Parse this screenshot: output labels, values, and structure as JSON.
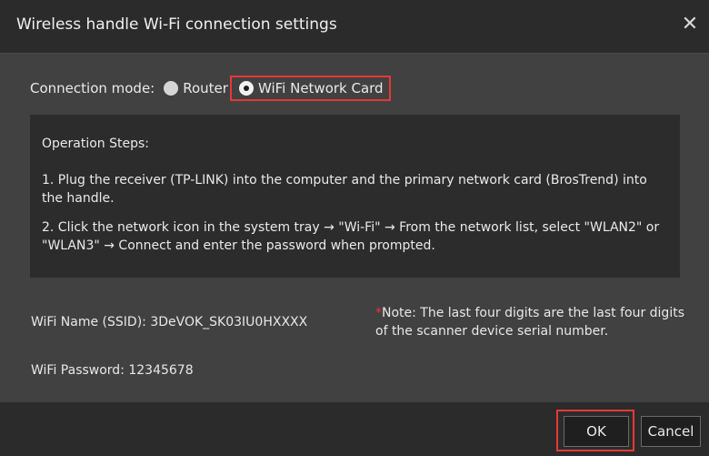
{
  "dialog": {
    "title": "Wireless handle Wi-Fi connection settings",
    "close_glyph": "✕"
  },
  "connection": {
    "label": "Connection mode:",
    "options": [
      {
        "label": "Router",
        "selected": false
      },
      {
        "label": "WiFi Network Card",
        "selected": true
      }
    ]
  },
  "steps": {
    "heading": "Operation Steps:",
    "step1": "1. Plug the receiver (TP-LINK) into the computer and the primary network card (BrosTrend) into the handle.",
    "step2": "2. Click the network icon in the system tray → \"Wi-Fi\" → From the network list, select \"WLAN2\" or \"WLAN3\" → Connect and enter the password when prompted."
  },
  "wifi": {
    "ssid": "WiFi Name (SSID): 3DeVOK_SK03IU0HXXXX",
    "password": "WiFi Password: 12345678",
    "note_star": "*",
    "note": "Note: The last four digits are the last four digits of the scanner device serial number."
  },
  "buttons": {
    "ok": "OK",
    "cancel": "Cancel"
  },
  "colors": {
    "highlight": "#e53935",
    "background": "#414141",
    "bar": "#2b2b2b"
  }
}
